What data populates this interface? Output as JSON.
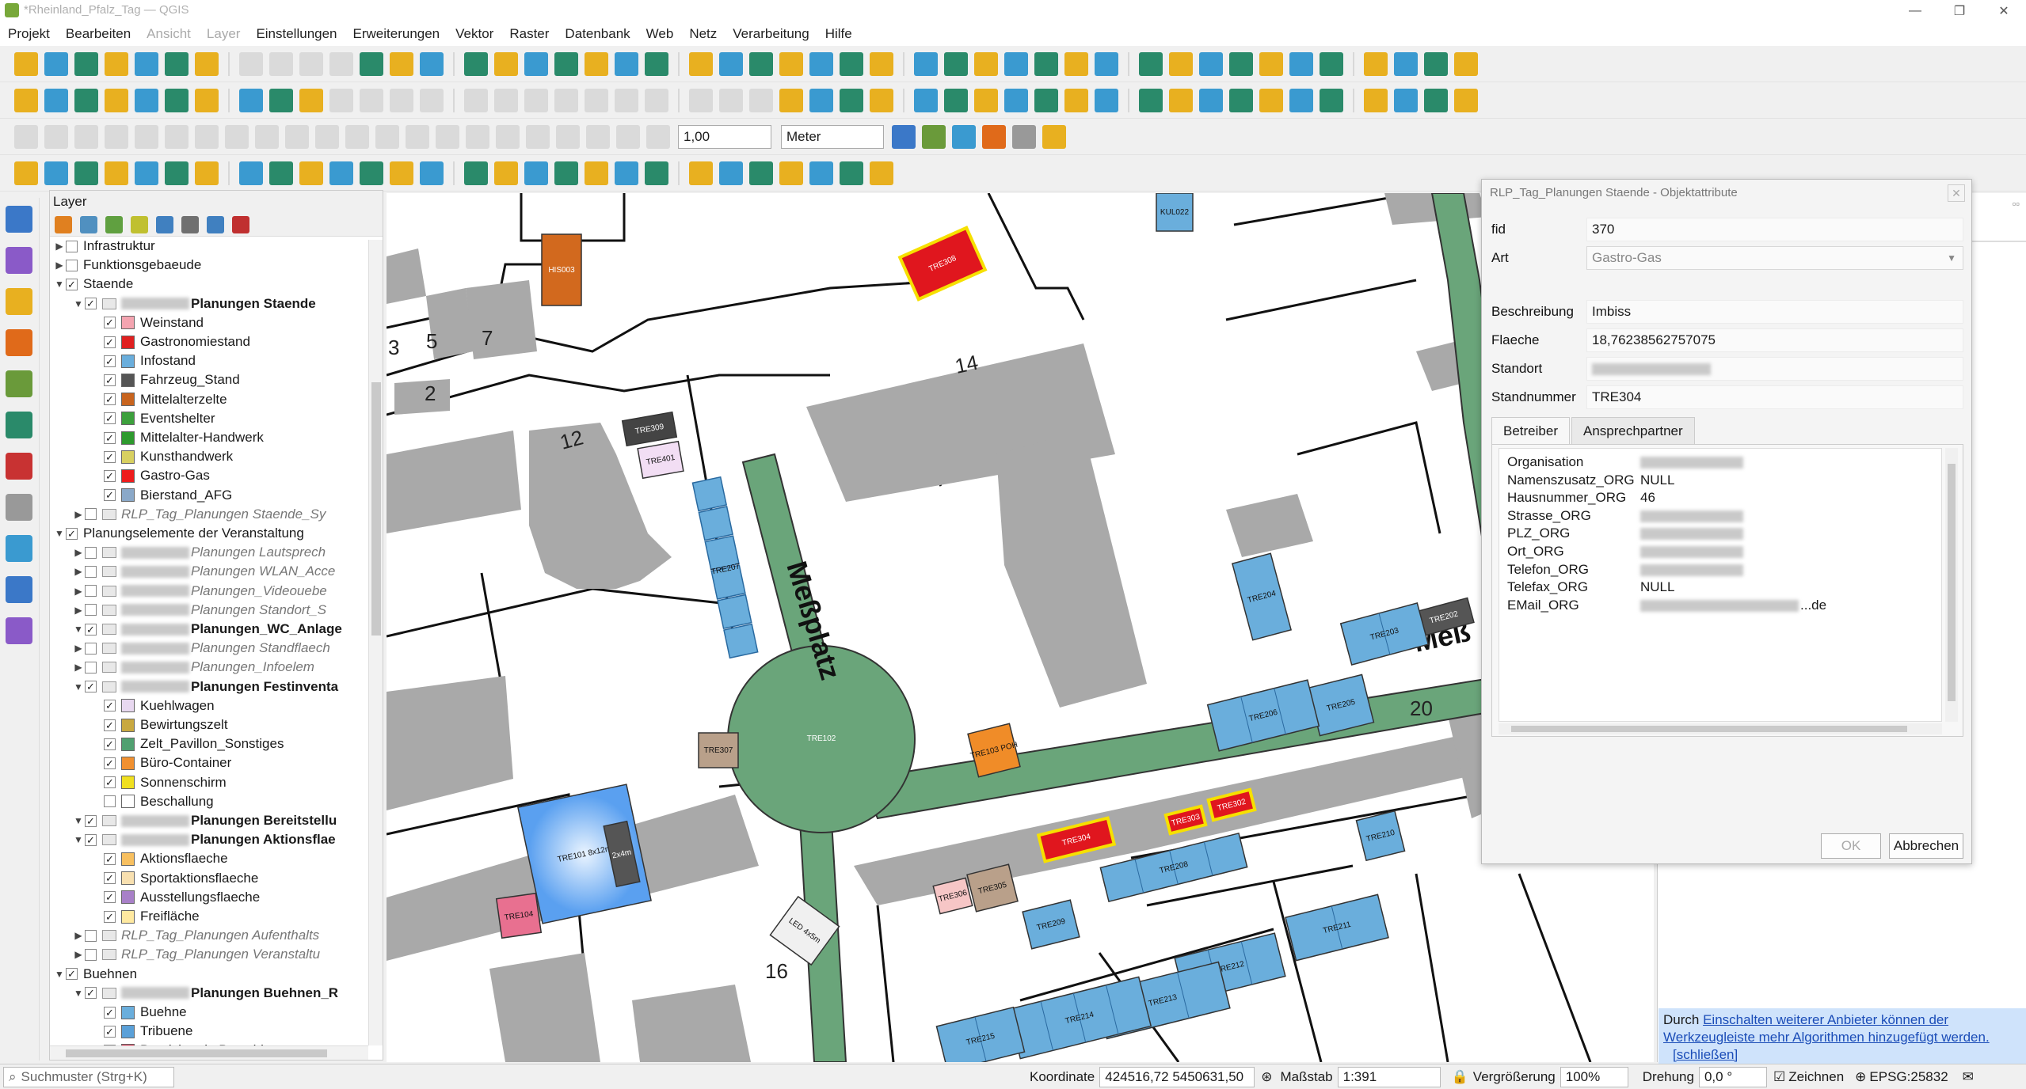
{
  "window": {
    "title": "*Rheinland_Pfalz_Tag — QGIS"
  },
  "menu": [
    "Projekt",
    "Bearbeiten",
    "Ansicht",
    "Layer",
    "Einstellungen",
    "Erweiterungen",
    "Vektor",
    "Raster",
    "Datenbank",
    "Web",
    "Netz",
    "Verarbeitung",
    "Hilfe"
  ],
  "toolbar": {
    "width_value": "1,00",
    "unit": "Meter"
  },
  "layer_panel": {
    "title": "Layer",
    "rows": [
      {
        "label": "Infrastruktur",
        "depth": 1,
        "type": "group"
      },
      {
        "label": "Funktionsgebaeude",
        "depth": 1,
        "type": "group"
      },
      {
        "label": "Staende",
        "depth": 1,
        "type": "group",
        "checked": true
      },
      {
        "label": "Planungen Staende",
        "depth": 2,
        "type": "layer",
        "bold": true,
        "checked": true
      },
      {
        "label": "Weinstand",
        "depth": 3,
        "swatch": "#f4a4b0",
        "checked": true
      },
      {
        "label": "Gastronomiestand",
        "depth": 3,
        "swatch": "#e02020",
        "checked": true
      },
      {
        "label": "Infostand",
        "depth": 3,
        "swatch": "#6aaedc",
        "checked": true
      },
      {
        "label": "Fahrzeug_Stand",
        "depth": 3,
        "swatch": "#555555",
        "checked": true
      },
      {
        "label": "Mittelalterzelte",
        "depth": 3,
        "swatch": "#c8641e",
        "checked": true
      },
      {
        "label": "Eventshelter",
        "depth": 3,
        "swatch": "#3ca03c",
        "checked": true
      },
      {
        "label": "Mittelalter-Handwerk",
        "depth": 3,
        "swatch": "#2e9a2e",
        "checked": true
      },
      {
        "label": "Kunsthandwerk",
        "depth": 3,
        "swatch": "#d8d060",
        "checked": true
      },
      {
        "label": "Gastro-Gas",
        "depth": 3,
        "swatch": "#ee1c1c",
        "checked": true
      },
      {
        "label": "Bierstand_AFG",
        "depth": 3,
        "swatch": "#8aa8c8",
        "checked": true
      },
      {
        "label": "RLP_Tag_Planungen Staende_Sy",
        "depth": 2,
        "type": "layer",
        "italic": true
      },
      {
        "label": "Planungselemente der Veranstaltung",
        "depth": 1,
        "type": "group",
        "checked": true
      },
      {
        "label": "Planungen Lautsprech",
        "depth": 2,
        "italic": true
      },
      {
        "label": "Planungen WLAN_Acce",
        "depth": 2,
        "italic": true
      },
      {
        "label": "Planungen_Videouebe",
        "depth": 2,
        "italic": true
      },
      {
        "label": "Planungen Standort_S",
        "depth": 2,
        "italic": true
      },
      {
        "label": "Planungen_WC_Anlage",
        "depth": 2,
        "bold": true,
        "checked": true
      },
      {
        "label": "Planungen Standflaech",
        "depth": 2,
        "italic": true
      },
      {
        "label": "Planungen_Infoelem",
        "depth": 2,
        "italic": true
      },
      {
        "label": "Planungen Festinventa",
        "depth": 2,
        "bold": true,
        "checked": true
      },
      {
        "label": "Kuehlwagen",
        "depth": 3,
        "swatch": "#e8d8f0",
        "checked": true
      },
      {
        "label": "Bewirtungszelt",
        "depth": 3,
        "swatch": "#c8a840",
        "checked": true
      },
      {
        "label": "Zelt_Pavillon_Sonstiges",
        "depth": 3,
        "swatch": "#50a070",
        "checked": true
      },
      {
        "label": "Büro-Container",
        "depth": 3,
        "swatch": "#f09030",
        "checked": true
      },
      {
        "label": "Sonnenschirm",
        "depth": 3,
        "swatch": "#f0e020",
        "checked": true
      },
      {
        "label": "Beschallung",
        "depth": 3,
        "swatch": "#ffffff",
        "checked": false
      },
      {
        "label": "Planungen Bereitstellu",
        "depth": 2,
        "bold": true,
        "checked": true
      },
      {
        "label": "Planungen Aktionsflae",
        "depth": 2,
        "bold": true,
        "checked": true
      },
      {
        "label": "Aktionsflaeche",
        "depth": 3,
        "swatch": "#f8c060",
        "checked": true
      },
      {
        "label": "Sportaktionsflaeche",
        "depth": 3,
        "swatch": "#f8e0b0",
        "checked": true
      },
      {
        "label": "Ausstellungsflaeche",
        "depth": 3,
        "swatch": "#a880c8",
        "checked": true
      },
      {
        "label": "Freifläche",
        "depth": 3,
        "swatch": "#ffe9a0",
        "checked": true
      },
      {
        "label": "RLP_Tag_Planungen Aufenthalts",
        "depth": 2,
        "italic": true
      },
      {
        "label": "RLP_Tag_Planungen Veranstaltu",
        "depth": 2,
        "italic": true
      },
      {
        "label": "Buehnen",
        "depth": 1,
        "type": "group",
        "checked": true
      },
      {
        "label": "Planungen Buehnen_R",
        "depth": 2,
        "bold": true,
        "checked": true
      },
      {
        "label": "Buehne",
        "depth": 3,
        "swatch": "#6aaedc",
        "checked": true
      },
      {
        "label": "Tribuene",
        "depth": 3,
        "swatch": "#5aa0d8",
        "checked": true
      },
      {
        "label": "Bereich_mit_Bestuhlung",
        "depth": 3,
        "swatch": "#e03050",
        "checked": true
      }
    ]
  },
  "map": {
    "street_label_1": "Meßplatz",
    "street_label_2": "Meß",
    "house_numbers": [
      "3",
      "5",
      "7",
      "2",
      "12",
      "14",
      "20",
      "16"
    ],
    "features": [
      {
        "id": "HIS003",
        "color": "#d2691e"
      },
      {
        "id": "TRE308",
        "color": "#e0161e"
      },
      {
        "id": "KUL022",
        "color": "#6aaedc"
      },
      {
        "id": "TRE309",
        "color": "#444444"
      },
      {
        "id": "TRE401",
        "color": "#f2def4"
      },
      {
        "id": "TRE207",
        "color": "#6aaedc"
      },
      {
        "id": "TRE204",
        "color": "#6aaedc"
      },
      {
        "id": "TRE202",
        "color": "#555555"
      },
      {
        "id": "TRE203",
        "color": "#6aaedc"
      },
      {
        "id": "TRE205",
        "color": "#6aaedc"
      },
      {
        "id": "TRE206",
        "color": "#6aaedc"
      },
      {
        "id": "TRE103 POH",
        "color": "#f08c28"
      },
      {
        "id": "TRE307",
        "color": "#b9a08a"
      },
      {
        "id": "TRE102",
        "color": "#55a07d"
      },
      {
        "id": "TRE101 8x12m",
        "color": "#7ab4f0"
      },
      {
        "id": "2x4m",
        "color": "#555555"
      },
      {
        "id": "TRE104",
        "color": "#e87090"
      },
      {
        "id": "LED 4x5m",
        "color": "#f0f0f0"
      },
      {
        "id": "TRE303",
        "color": "#e0161e"
      },
      {
        "id": "TRE302",
        "color": "#e0161e"
      },
      {
        "id": "TRE304",
        "color": "#e0161e"
      },
      {
        "id": "TRE306",
        "color": "#f6c6c6"
      },
      {
        "id": "TRE305",
        "color": "#b9a08a"
      },
      {
        "id": "TRE208",
        "color": "#6aaedc"
      },
      {
        "id": "TRE209",
        "color": "#6aaedc"
      },
      {
        "id": "TRE210",
        "color": "#6aaedc"
      },
      {
        "id": "TRE211",
        "color": "#6aaedc"
      },
      {
        "id": "TRE212",
        "color": "#6aaedc"
      },
      {
        "id": "TRE213",
        "color": "#6aaedc"
      },
      {
        "id": "TRE214",
        "color": "#6aaedc"
      },
      {
        "id": "TRE215",
        "color": "#6aaedc"
      }
    ]
  },
  "dialog": {
    "title": "RLP_Tag_Planungen Staende - Objektattribute",
    "fields": {
      "fid": {
        "label": "fid",
        "value": "370"
      },
      "art": {
        "label": "Art",
        "value": "Gastro-Gas"
      },
      "beschreibung": {
        "label": "Beschreibung",
        "value": "Imbiss"
      },
      "flaeche": {
        "label": "Flaeche",
        "value": "18,76238562757075"
      },
      "standort": {
        "label": "Standort",
        "value": ""
      },
      "standnummer": {
        "label": "Standnummer",
        "value": "TRE304"
      }
    },
    "tabs": [
      "Betreiber",
      "Ansprechpartner"
    ],
    "betreiber": [
      {
        "label": "Organisation",
        "value": "",
        "blurred": true
      },
      {
        "label": "Namenszusatz_ORG",
        "value": "NULL"
      },
      {
        "label": "Hausnummer_ORG",
        "value": "46"
      },
      {
        "label": "Strasse_ORG",
        "value": "",
        "blurred": true
      },
      {
        "label": "PLZ_ORG",
        "value": "",
        "blurred": true
      },
      {
        "label": "Ort_ORG",
        "value": "",
        "blurred": true
      },
      {
        "label": "Telefon_ORG",
        "value": "",
        "blurred": true
      },
      {
        "label": "Telefax_ORG",
        "value": "NULL"
      },
      {
        "label": "EMail_ORG",
        "value": "...de",
        "blurred": true
      }
    ],
    "ok": "OK",
    "cancel": "Abbrechen"
  },
  "notice": {
    "prefix": "Durch ",
    "link1": "Einschalten weiterer Anbieter können der Werkzeugleiste mehr Algorithmen hinzugefügt werden.",
    "link2": "[schließen]"
  },
  "statusbar": {
    "search_placeholder": "Suchmuster (Strg+K)",
    "coord_label": "Koordinate",
    "coord_value": "424516,72 5450631,50",
    "scale_label": "Maßstab",
    "scale_value": "1:391",
    "zoom_label": "Vergrößerung",
    "zoom_value": "100%",
    "rotation_label": "Drehung",
    "rotation_value": "0,0 °",
    "render_label": "Zeichnen",
    "crs": "EPSG:25832"
  },
  "colors": {
    "road": "#6aa57a",
    "building": "#a9a9a9",
    "accent": "#1b4db8"
  }
}
